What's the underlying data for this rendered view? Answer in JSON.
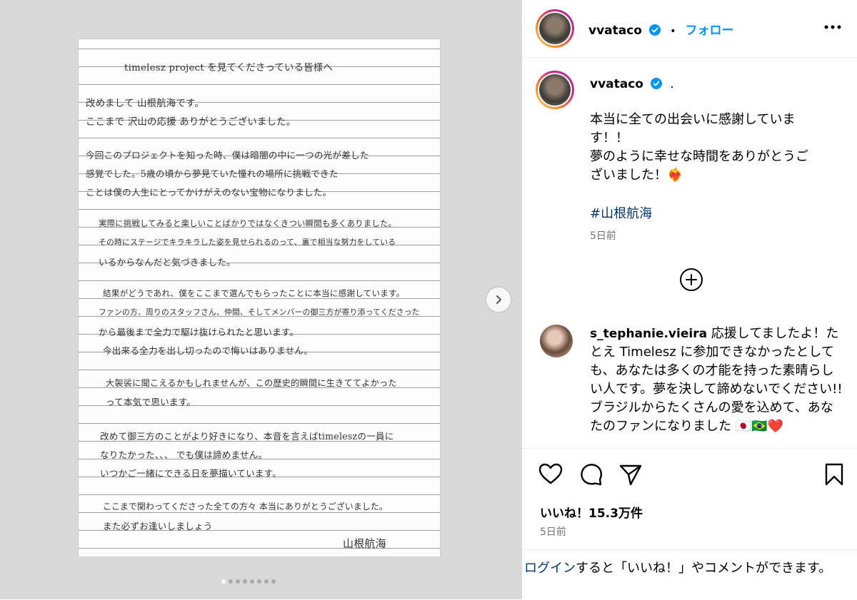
{
  "letter": {
    "lines": [
      "timelesz project を見てくださっている皆様へ",
      "改めまして 山根航海です。",
      "ここまで 沢山の応援 ありがとうございました。",
      "今回このプロジェクトを知った時、僕は暗闇の中に一つの光が差した",
      "感覚でした。5歳の頃から夢見ていた憧れの場所に挑戦できた",
      "ことは僕の人生にとってかけがえのない宝物になりました。",
      "実際に挑戦してみると楽しいことばかりではなくきつい瞬間も多くありました。",
      "その時にステージでキラキラした姿を見せられるのって、裏で相当な努力をしている",
      "いるからなんだと気づきました。",
      "結果がどうであれ、僕をここまで選んでもらったことに本当に感謝しています。",
      "ファンの方、周りのスタッフさん、仲間、そしてメンバーの御三方が寄り添ってくださった",
      "から最後まで全力で駆け抜けられたと思います。",
      "今出来る全力を出し切ったので悔いはありません。",
      "大袈裟に聞こえるかもしれませんが、この歴史的瞬間に生きててよかった",
      "って本気で思います。",
      "改めて御三方のことがより好きになり、本音を言えばtimeleszの一員に",
      "なりたかった、、、 でも僕は諦めません。",
      "いつかご一緒にできる日を夢描いています。",
      "ここまで関わってくださった全ての方々 本当にありがとうございました。",
      "また必ずお逢いしましょう",
      "山根航海"
    ]
  },
  "post": {
    "username": "vvataco",
    "follow_label": "フォロー",
    "separator": "•",
    "caption_suffix": ".",
    "caption": "本当に全ての出会いに感謝していま\nす！！\n夢のように幸せな時間をありがとうご\nざいました！❤️‍🔥",
    "hashtag": "#山根航海",
    "caption_time": "5日前",
    "likes": "いいね！15.3万件",
    "post_time": "5日前",
    "login_link": "ログイン",
    "login_rest": "すると「いいね！」やコメントができます。"
  },
  "comment": {
    "username": "s_tephanie.vieira",
    "text": "応援してましたよ！たとえ Timelesz に参加できなかったとしても、あなたは多くの才能を持った素晴らしい人です。夢を決して諦めないでください!!ブラジルからたくさんの愛を込めて、あなたのファンになりました 🇯🇵🇧🇷❤️"
  },
  "carousel": {
    "count": 8,
    "active": 0
  },
  "icons": {
    "verified": "verified-badge-icon",
    "next": "chevron-right-icon",
    "load_more": "plus-circle-icon",
    "like": "heart-icon",
    "comment": "comment-bubble-icon",
    "share": "paper-plane-icon",
    "save": "bookmark-icon"
  },
  "colors": {
    "accent": "#0095f6",
    "link": "#00376b",
    "verified": "#0095f6",
    "muted": "#737373"
  }
}
